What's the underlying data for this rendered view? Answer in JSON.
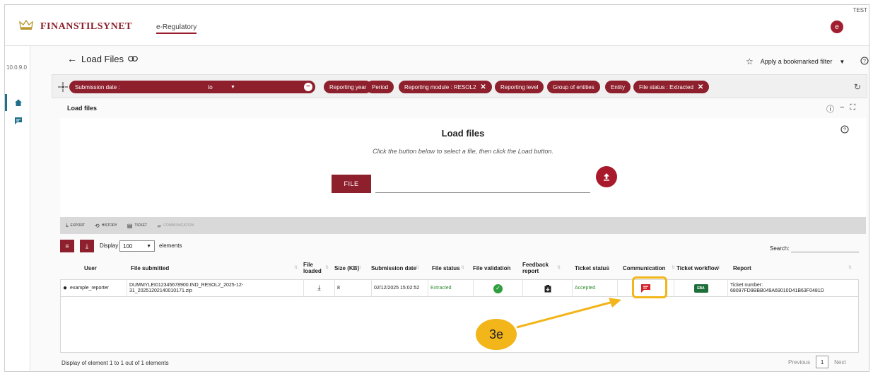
{
  "header": {
    "brand": "FINANSTILSYNET",
    "app_name": "e-Regulatory",
    "env_label": "TEST",
    "avatar_initial": "e"
  },
  "rail": {
    "version": "10.0.9.0"
  },
  "page": {
    "title": "Load Files",
    "bookmark_filter": "Apply a bookmarked filter"
  },
  "filters": {
    "submission_label": "Submission date :",
    "to_label": "to",
    "chips": [
      {
        "label": "Reporting year",
        "removable": false
      },
      {
        "label": "Period",
        "removable": false
      },
      {
        "label": "Reporting module : RESOL2",
        "removable": true
      },
      {
        "label": "Reporting level",
        "removable": false
      },
      {
        "label": "Group of entities",
        "removable": false
      },
      {
        "label": "Entity",
        "removable": false
      },
      {
        "label": "File status : Extracted",
        "removable": true
      }
    ]
  },
  "panel": {
    "title": "Load files",
    "upload_title": "Load files",
    "upload_instructions": "Click the button below to select a file, then click the Load button.",
    "file_button": "FILE"
  },
  "toolbar": {
    "export": "Export",
    "history": "History",
    "ticket": "Ticket",
    "communication": "Communication"
  },
  "controls": {
    "display": "Display",
    "page_size": "100",
    "elements": "elements",
    "search": "Search:"
  },
  "table": {
    "columns": [
      "User",
      "File submitted",
      "File loaded",
      "Size (KB)",
      "Submission date",
      "File status",
      "File validation",
      "Feedback report",
      "Ticket status",
      "Communication",
      "Ticket workflow",
      "Report"
    ],
    "rows": [
      {
        "user": "example_reporter",
        "file_submitted": "DUMMYLEI012345678900.IND_RESOL2_2025-12-31_20251202140010171.zip",
        "size": "8",
        "submission_date": "02/12/2025 15:02:52",
        "file_status": "Extracted",
        "ticket_status": "Accepted",
        "ticket_workflow": "EBA",
        "report_label": "Ticket number:",
        "report_value": "68097FD9BBB049A69010D41B63F0481D"
      }
    ]
  },
  "footer": {
    "info": "Display of element 1 to 1 out of 1 elements",
    "previous": "Previous",
    "page": "1",
    "next": "Next"
  },
  "annotation": {
    "step": "3e"
  },
  "colors": {
    "brand": "#8e1f2c",
    "highlight": "#f2b51a",
    "success": "#2e9e3e"
  }
}
